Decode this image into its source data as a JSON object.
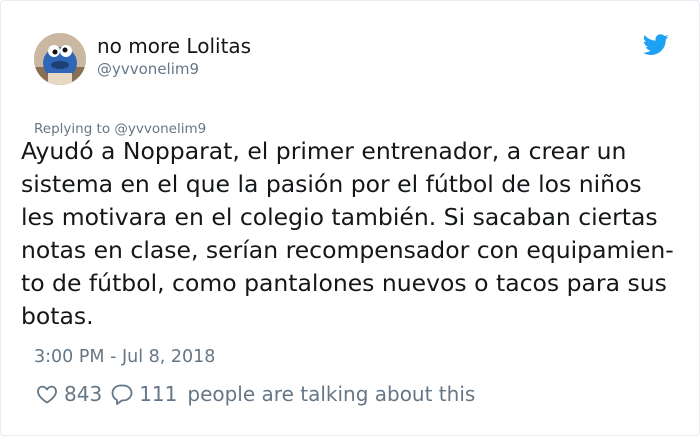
{
  "author": {
    "display_name": "no more Lolitas",
    "handle": "@yvvonelim9"
  },
  "reply_context": "Replying to @yvvonelim9",
  "tweet": {
    "lines": [
      "Ayudó a Nopparat, el primer entrenador, a crear un",
      "sistema en el que la pasión por el fútbol de los niños",
      "les motivara en el colegio también. Si sacaban ciertas",
      "notas en clase, serían recompensador con equipamien-",
      "to de fútbol, como pantalones nuevos o tacos para sus",
      "botas."
    ],
    "timestamp": "3:00 PM - Jul 8, 2018"
  },
  "engagement": {
    "likes": "843",
    "replies": "111",
    "talking_text": "people are talking about this"
  },
  "icons": {
    "brand": "twitter-bird-icon",
    "like": "heart-icon",
    "reply": "speech-bubble-icon"
  },
  "colors": {
    "text": "#14171a",
    "secondary": "#657786",
    "twitter_blue": "#1da1f2",
    "border": "#e6ecf0"
  }
}
